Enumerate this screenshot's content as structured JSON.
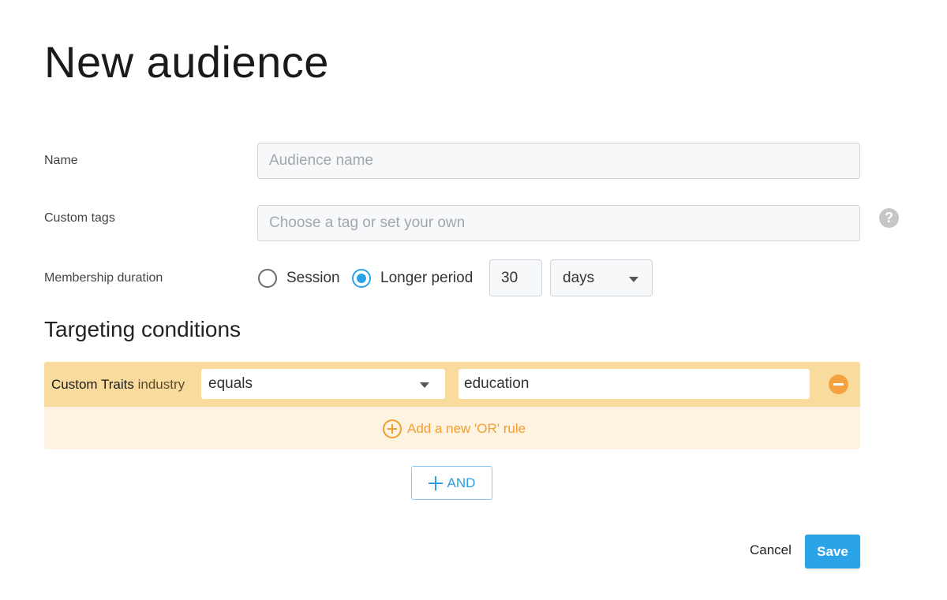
{
  "page": {
    "title": "New audience"
  },
  "form": {
    "name": {
      "label": "Name",
      "placeholder": "Audience name",
      "value": ""
    },
    "custom_tags": {
      "label": "Custom tags",
      "placeholder": "Choose a tag or set your own",
      "value": "",
      "help_icon": "question-mark-icon"
    },
    "membership_duration": {
      "label": "Membership duration",
      "options": [
        {
          "label": "Session",
          "selected": false
        },
        {
          "label": "Longer period",
          "selected": true
        }
      ],
      "amount": "30",
      "unit": "days"
    }
  },
  "targeting": {
    "title": "Targeting conditions",
    "conditions": [
      {
        "trait_group": "Custom Traits",
        "trait_name": "industry",
        "operator": "equals",
        "value": "education"
      }
    ],
    "add_or_label": "Add a new 'OR' rule",
    "add_and_label": "AND"
  },
  "actions": {
    "cancel_label": "Cancel",
    "save_label": "Save"
  },
  "colors": {
    "accent_blue": "#2ba3e8",
    "condition_row": "#fadb9e",
    "condition_block": "#fdf3e0",
    "orange": "#f0a033"
  }
}
